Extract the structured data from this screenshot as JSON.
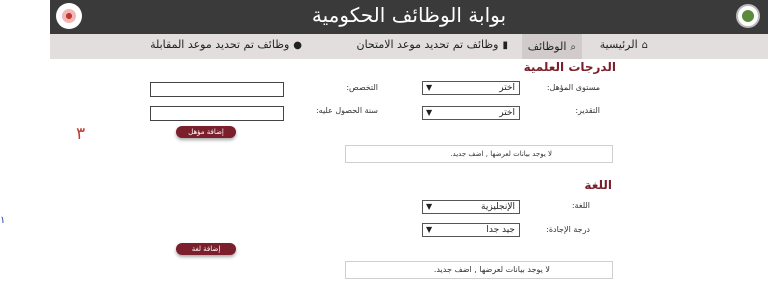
{
  "header": {
    "title": "بوابة الوظائف الحكومية"
  },
  "nav": {
    "home": "الرئيسية",
    "jobs": "الوظائف",
    "exam_jobs": "وظائف تم تحديد موعد الامتحان",
    "interview_jobs": "وظائف تم تحديد موعد المقابلة"
  },
  "degrees": {
    "title": "الدرجات العلمية",
    "qualification_label": "مستوى المؤهل:",
    "qualification_value": "اختر",
    "specialization_label": "التخصص:",
    "grade_label": "التقدير:",
    "grade_value": "اختر",
    "year_label": "سنة الحصول عليه:",
    "add_button": "إضافة مؤهل",
    "empty_text": "لا يوجد بيانات لعرضها , اضف جديد."
  },
  "language": {
    "title": "اللغة",
    "language_label": "اللغة:",
    "language_value": "الإنجليزية",
    "level_label": "درجة الإجادة:",
    "level_value": "جيد جدا",
    "add_button": "إضافة لغة",
    "empty_text": "لا يوجد بيانات لعرضها , اضف جديد."
  },
  "annotations": {
    "number_three": "٣",
    "number_one": "١"
  },
  "icons": {
    "home": "home-icon",
    "search": "search-icon",
    "file": "file-icon",
    "user": "user-icon"
  },
  "colors": {
    "header_bg": "#3a3a3a",
    "nav_bg": "#e3dede",
    "accent": "#7a1f2b"
  }
}
